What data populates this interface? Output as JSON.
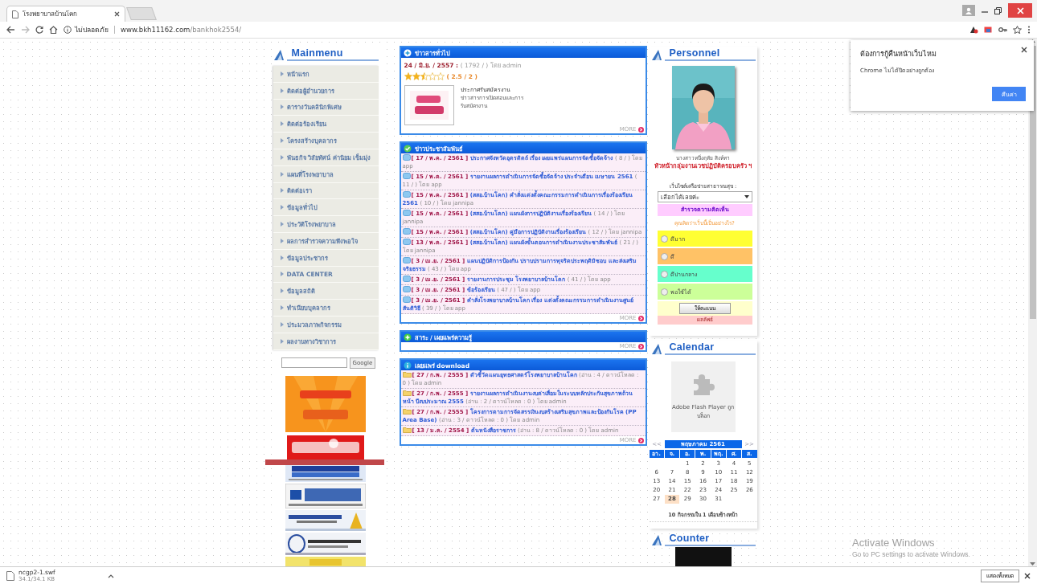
{
  "browser": {
    "tab_title": "โรงพยาบาลบ้านโคก",
    "security_label": "ไม่ปลอดภัย",
    "url_host": "www.bkh11162.com",
    "url_path": "/bankhok2554/"
  },
  "main_menu": {
    "title": "Mainmenu",
    "items": [
      "หน้าแรก",
      "ติดต่อผู้อำนวยการ",
      "ตารางวันคลินิกพิเศษ",
      "ติดต่อร้องเรียน",
      "โครงสร้างบุคลากร",
      "พันธกิจ วิสัยทัศน์ ค่านิยม เข็มมุ่ง",
      "แผนที่โรงพยาบาล",
      "ติดต่อเรา",
      "ข้อมูลทั่วไป",
      "ประวัติโรงพยาบาล",
      "ผลการสำรวจความพึงพอใจ",
      "ข้อมูลประชากร",
      "DATA CENTER",
      "ข้อมูลสถิติ",
      "ทำเนียบบุคลากร",
      "ประมวลภาพกิจกรรม",
      "ผลงานทางวิชาการ"
    ],
    "search_button": "Google"
  },
  "general_news": {
    "title": "ข่าวสารทั่วไป",
    "date": "24 / มิ.ย. / 2557 :",
    "meta": "( 1792 / ) โดย admin",
    "stars": 2.5,
    "rating": "( 2.5 / 2 )",
    "headline": "ประกาศรับสมัครงาน",
    "summary": "ข่าวสารการเปิดสอบและการรับสมัครงาน",
    "more": "MORE"
  },
  "pr_news": {
    "title": "ข่าวประชาสัมพันธ์",
    "items": [
      {
        "date": "[ 17 / พ.ค. / 2561 ]",
        "title": "ประกาศจังหวัดอุตรดิตถ์ เรื่อง เผยแพร่แผนการจัดซื้อจัดจ้าง",
        "meta": "( 8 / ) โดย app"
      },
      {
        "date": "[ 15 / พ.ค. / 2561 ]",
        "title": "รายงานผลการดำเนินการจัดซื้อจัดจ้าง ประจำเดือน เมษายน 2561",
        "meta": "( 11 / ) โดย app"
      },
      {
        "date": "[ 15 / พ.ค. / 2561 ]",
        "title": "(สสอ.บ้านโคก) คำสั่งแต่งตั้งคณะกรรมการดำเนินการเรื่องร้องเรียน 2561",
        "meta": "( 10 / ) โดย jannipa"
      },
      {
        "date": "[ 15 / พ.ค. / 2561 ]",
        "title": "(สสอ.บ้านโคก) แผนผังการปฏิบัติงานเรื่องร้องเรียน",
        "meta": "( 14 / ) โดย jannipa"
      },
      {
        "date": "[ 15 / พ.ค. / 2561 ]",
        "title": "(สสอ.บ้านโคก) คู่มือการปฏิบัติงานเรื่องร้องเรียน",
        "meta": "( 12 / ) โดย jannipa"
      },
      {
        "date": "[ 13 / พ.ค. / 2561 ]",
        "title": "(สสอ.บ้านโคก) แผนผังขั้นตอนการดำเนินงานประชาสัมพันธ์",
        "meta": "( 21 / ) โดย jannipa"
      },
      {
        "date": "[ 3 / เม.ย. / 2561 ]",
        "title": "แผนปฏิบัติการป้องกัน ปราบปรามการทุจริตประพฤติมิชอบ และส่งเสริมจริยธรรม",
        "meta": "( 43 / ) โดย app"
      },
      {
        "date": "[ 3 / เม.ย. / 2561 ]",
        "title": "รายงานการประชุม โรงพยาบาลบ้านโคก",
        "meta": "( 41 / ) โดย app"
      },
      {
        "date": "[ 3 / เม.ย. / 2561 ]",
        "title": "ข้อร้องเรียน",
        "meta": "( 47 / ) โดย app"
      },
      {
        "date": "[ 3 / เม.ย. / 2561 ]",
        "title": "คำสั่งโรงพยาบาลบ้านโคก เรื่อง แต่งตั้งคณะกรรมการดำเนินงานศูนย์สันติวิธี",
        "meta": "( 39 / ) โดย app"
      }
    ],
    "more": "MORE"
  },
  "knowledge": {
    "title": "สาระ / เผยแพร่ความรู้",
    "more": "MORE"
  },
  "download_news": {
    "title": "เผยแพร่ download",
    "items": [
      {
        "date": "[ 27 / ก.พ. / 2555 ]",
        "title": "ตัวชี้วัดแผนยุทธศาสตร์โรงพยาบาลบ้านโคก",
        "meta": "(อ่าน : 4 / ดาวน์โหลด : 0 ) โดย admin"
      },
      {
        "date": "[ 27 / ก.พ. / 2555 ]",
        "title": "รายงานผลการดำเนินงานงบค่าเสื่อมในระบบหลักประกันสุขภาพถ้วนหน้า ปีงบประมาณ 2555",
        "meta": "(อ่าน : 2 / ดาวน์โหลด : 0 ) โดย admin"
      },
      {
        "date": "[ 27 / ก.พ. / 2555 ]",
        "title": "โครงการตามการจัดสรรเงินงบสร้างเสริมสุขภาพและป้องกันโรค (PP Area Base)",
        "meta": "(อ่าน : 3 / ดาวน์โหลด : 0 ) โดย admin"
      },
      {
        "date": "[ 13 / ม.ค. / 2554 ]",
        "title": "ต้นหนังสือราชการ",
        "meta": "(อ่าน : 8 / ดาวน์โหลด : 0 ) โดย admin"
      }
    ],
    "more": "MORE"
  },
  "personnel": {
    "title": "Personnel",
    "name": "นางสาวหนึ่งฤทัย สิงห์ทา",
    "position": "หัวหน้ากลุ่มงานเวชปฏิบัติครอบครัว ฯ",
    "network_label": "เว็บไซต์เครือข่ายสาธารณสุข :",
    "network_select": "เลือกได้เลยค่ะ"
  },
  "poll": {
    "title": "สำรวจความคิดเห็น",
    "question": "คุณคิดว่าเว็บนี้เป็นอย่างไร?",
    "options": [
      {
        "label": "ดีมาก",
        "color": "#ffff33",
        "selected": false
      },
      {
        "label": "ดี",
        "color": "#ffc266",
        "selected": false
      },
      {
        "label": "ดีปานกลาง",
        "color": "#66ffcc",
        "selected": false
      },
      {
        "label": "พอใช้ได้",
        "color": "#ccff99",
        "selected": false
      }
    ],
    "vote_button": "ให้คะแนน",
    "results": "ผลลัพธ์"
  },
  "calendar": {
    "title": "Calendar",
    "flash_message": "Adobe Flash Player ถูกบล็อก",
    "prev": "<<",
    "month": "พฤษภาคม 2561",
    "next": ">>",
    "weekdays": [
      "อา.",
      "จ.",
      "อ.",
      "พ.",
      "พฤ.",
      "ศ.",
      "ส."
    ],
    "weeks": [
      [
        {
          "label": "1",
          "selected": false
        },
        {
          "label": "2",
          "selected": false
        },
        {
          "label": "3",
          "selected": false
        },
        {
          "label": "4",
          "selected": false
        },
        {
          "label": "5",
          "selected": false
        }
      ],
      [
        {
          "label": "6",
          "selected": false
        },
        {
          "label": "7",
          "selected": false
        },
        {
          "label": "8",
          "selected": false
        },
        {
          "label": "9",
          "selected": false
        },
        {
          "label": "10",
          "selected": false
        },
        {
          "label": "11",
          "selected": false
        },
        {
          "label": "12",
          "selected": false
        }
      ],
      [
        {
          "label": "13",
          "selected": false
        },
        {
          "label": "14",
          "selected": false
        },
        {
          "label": "15",
          "selected": false
        },
        {
          "label": "16",
          "selected": false
        },
        {
          "label": "17",
          "selected": false
        },
        {
          "label": "18",
          "selected": false
        },
        {
          "label": "19",
          "selected": false
        }
      ],
      [
        {
          "label": "20",
          "selected": false
        },
        {
          "label": "21",
          "selected": false
        },
        {
          "label": "22",
          "selected": false
        },
        {
          "label": "23",
          "selected": false
        },
        {
          "label": "24",
          "selected": false
        },
        {
          "label": "25",
          "selected": false
        },
        {
          "label": "26",
          "selected": false
        }
      ],
      [
        {
          "label": "27",
          "selected": false
        },
        {
          "label": "28",
          "selected": true
        },
        {
          "label": "29",
          "selected": false
        },
        {
          "label": "30",
          "selected": false
        },
        {
          "label": "31",
          "selected": false
        }
      ]
    ],
    "events": "10 กิจกรรมใน 1 เดือนข้างหน้า"
  },
  "counter": {
    "title": "Counter"
  },
  "restore_popup": {
    "title": "ต้องการกู้คืนหน้าเว็บไหม",
    "message": "Chrome ไม่ได้ปิดอย่างถูกต้อง",
    "button": "คืนค่า"
  },
  "activation": {
    "title": "Activate Windows",
    "message": "Go to PC settings to activate Windows."
  },
  "download_bar": {
    "file": "ncgp2-1.swf",
    "progress": "34.1/34.1 KB",
    "show_all": "แสดงทั้งหมด"
  }
}
